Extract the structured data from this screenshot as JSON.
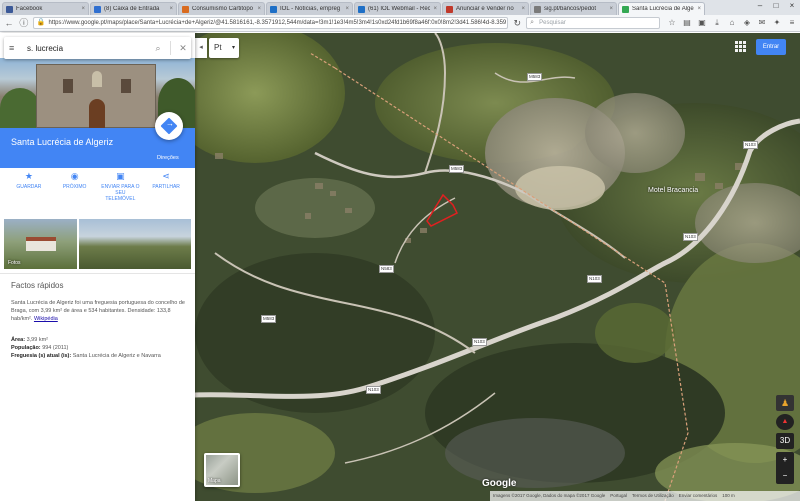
{
  "browser": {
    "tabs": [
      {
        "title": "Facebook",
        "favicon_color": "#3b5998"
      },
      {
        "title": "(8) Caixa de Entrada",
        "favicon_color": "#2f6fd0"
      },
      {
        "title": "Consumismo Cartitopo",
        "favicon_color": "#d96b1f"
      },
      {
        "title": "IOL - Notícias, empreg",
        "favicon_color": "#1e6fc6"
      },
      {
        "title": "(61) IOL Webmail - Rec",
        "favicon_color": "#1e6fc6"
      },
      {
        "title": "Anunciar e Vender no",
        "favicon_color": "#c0392b"
      },
      {
        "title": "sig.pt/bancos/pedot",
        "favicon_color": "#7a7a7a"
      },
      {
        "title": "Santa Lucrécia de Algeri",
        "favicon_color": "#34a853"
      }
    ],
    "url": "https://www.google.pt/maps/place/Santa+Lucrécia+de+Algeriz/@41.5816161,-8.3571912,544m/data=!3m1!1e3!4m5!3m4!1s0xd24fd1b69f8a46f:0x0!8m2!3d41.586!4d-8.359",
    "search_placeholder": "Pesquisar"
  },
  "panel": {
    "search_query": "s. lucrecia",
    "place_title": "Santa Lucrécia de Algeriz",
    "directions_label": "Direções",
    "actions": [
      {
        "icon": "star-icon",
        "glyph": "★",
        "label": "GUARDAR"
      },
      {
        "icon": "nearby-icon",
        "glyph": "◉",
        "label": "PRÓXIMO"
      },
      {
        "icon": "phone-icon",
        "glyph": "▣",
        "label": "ENVIAR PARA O SEU TELEMÓVEL"
      },
      {
        "icon": "share-icon",
        "glyph": "⋖",
        "label": "PARTILHAR"
      }
    ],
    "photos_label": "Fotos",
    "facts_heading": "Factos rápidos",
    "facts_body": "Santa Lucrécia de Algeriz foi uma freguesia portuguesa do concelho de Braga, com 3,99 km² de área e 534 habitantes. Densidade: 133,8 hab/km².",
    "facts_link": "Wikipédia",
    "area_label": "Área:",
    "area_value": "3,99 km²",
    "population_label": "População:",
    "population_value": "994 (2011)",
    "parish_label": "Freguesia (s) atual (is):",
    "parish_value": "Santa Lucrécia de Algeriz e Navarra"
  },
  "map": {
    "language": "Pt",
    "signin_label": "Entrar",
    "satellite_label": "Mapa",
    "place_label": "Motel Bracancia",
    "road_labels": [
      "M583",
      "M583",
      "N103",
      "N103",
      "N103",
      "N583",
      "N103",
      "M583",
      "N103"
    ],
    "google_logo": "Google",
    "attribution": [
      "Imagens ©2017 Google, Dados do mapa ©2017 Google",
      "Portugal",
      "Termos de Utilização",
      "Enviar comentários",
      "100 m"
    ],
    "colors": {
      "boundary": "#d9a07a",
      "highlight": "#e02020",
      "road": "#d8d4cc"
    }
  }
}
